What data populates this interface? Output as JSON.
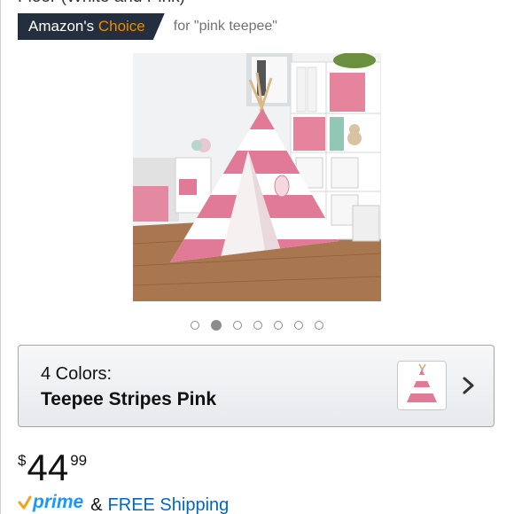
{
  "product": {
    "title_cutoff": "Floor (White and Pink)"
  },
  "badge": {
    "label_prefix": "Amazon's ",
    "label_accent": "Choice",
    "query": "for \"pink teepee\""
  },
  "gallery": {
    "dot_count": 7,
    "active_index": 1
  },
  "variant": {
    "count_label": "4 Colors:",
    "selected_name": "Teepee Stripes Pink"
  },
  "price": {
    "symbol": "$",
    "whole": "44",
    "fraction": "99"
  },
  "shipping": {
    "prime_label": "prime",
    "ampersand": "&",
    "free_shipping": "FREE Shipping"
  },
  "colors": {
    "badge_bg": "#232f3e",
    "badge_accent": "#f08804",
    "prime_blue": "#1a98ff",
    "link_blue": "#0066c0",
    "tent_pink": "#e07a96"
  },
  "icons": {
    "chevron": "chevron-right-icon",
    "prime_check": "prime-check-icon"
  }
}
